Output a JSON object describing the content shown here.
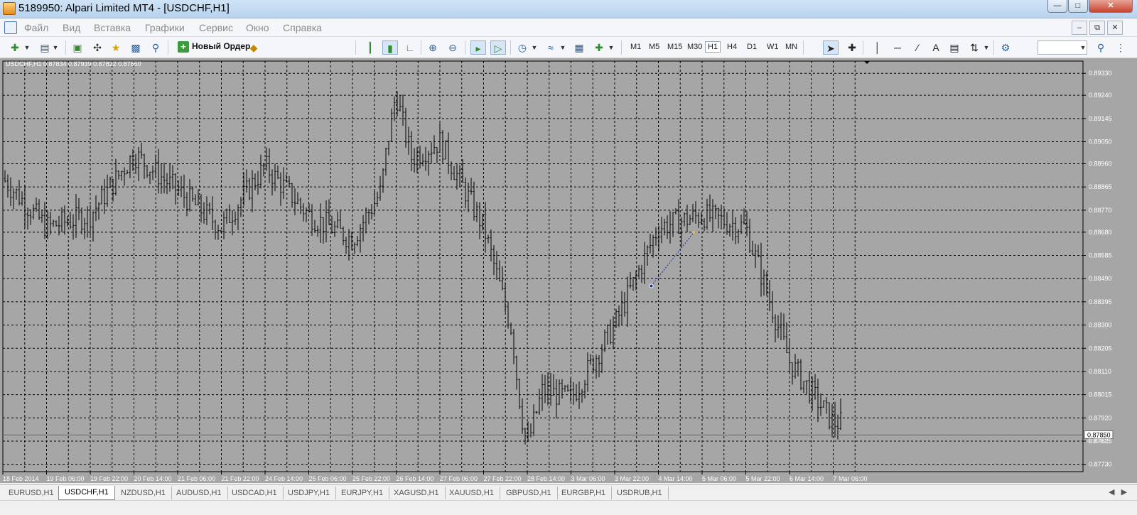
{
  "window": {
    "title": "5189950: Alpari Limited MT4 - [USDCHF,H1]"
  },
  "menu": [
    "Файл",
    "Вид",
    "Вставка",
    "Графики",
    "Сервис",
    "Окно",
    "Справка"
  ],
  "toolbar": {
    "new_order_label": "Новый Ордер",
    "timeframes": [
      "M1",
      "M5",
      "M15",
      "M30",
      "H1",
      "H4",
      "D1",
      "W1",
      "MN"
    ],
    "active_timeframe": "H1",
    "text_tool_label": "A"
  },
  "chart": {
    "symbol_info": "USDCHF,H1  0.87834 0.87939 0.87822 0.87850",
    "current_price": "0.87850",
    "below_price": "0.87825",
    "price_labels": [
      "0.89330",
      "0.89240",
      "0.89145",
      "0.89050",
      "0.88960",
      "0.88865",
      "0.88770",
      "0.88680",
      "0.88585",
      "0.88490",
      "0.88395",
      "0.88300",
      "0.88205",
      "0.88110",
      "0.88015",
      "0.87920",
      "0.87825",
      "0.87730"
    ],
    "time_labels": [
      "18 Feb 2014",
      "19 Feb 06:00",
      "19 Feb 22:00",
      "20 Feb 14:00",
      "21 Feb 06:00",
      "21 Feb 22:00",
      "24 Feb 14:00",
      "25 Feb 06:00",
      "25 Feb 22:00",
      "26 Feb 14:00",
      "27 Feb 06:00",
      "27 Feb 22:00",
      "28 Feb 14:00",
      "3 Mar 06:00",
      "3 Mar 22:00",
      "4 Mar 14:00",
      "5 Mar 06:00",
      "5 Mar 22:00",
      "6 Mar 14:00",
      "7 Mar 06:00"
    ],
    "colors": {
      "background": "#a6a6a6",
      "grid": "#000000",
      "bars": "#000000",
      "text": "#ffffff",
      "trendline": "#1a2aa6"
    }
  },
  "chart_data": {
    "type": "ohlc",
    "symbol": "USDCHF",
    "timeframe": "H1",
    "ylim": [
      0.877,
      0.8938
    ],
    "x": [
      "18 Feb 2014",
      "19 Feb 06:00",
      "19 Feb 22:00",
      "20 Feb 14:00",
      "21 Feb 06:00",
      "21 Feb 22:00",
      "24 Feb 14:00",
      "25 Feb 06:00",
      "25 Feb 22:00",
      "26 Feb 14:00",
      "27 Feb 06:00",
      "27 Feb 22:00",
      "28 Feb 14:00",
      "3 Mar 06:00",
      "3 Mar 22:00",
      "4 Mar 14:00",
      "5 Mar 06:00",
      "5 Mar 22:00",
      "6 Mar 14:00",
      "7 Mar 06:00"
    ],
    "close_path": [
      [
        0,
        0.889
      ],
      [
        1,
        0.887
      ],
      [
        2,
        0.8875
      ],
      [
        3,
        0.89
      ],
      [
        4,
        0.8885
      ],
      [
        5,
        0.887
      ],
      [
        6,
        0.8895
      ],
      [
        7,
        0.8875
      ],
      [
        8,
        0.8865
      ],
      [
        9,
        0.8895
      ],
      [
        10,
        0.8905
      ],
      [
        11,
        0.887
      ],
      [
        12,
        0.8805
      ],
      [
        13,
        0.88
      ],
      [
        14,
        0.883
      ],
      [
        15,
        0.887
      ],
      [
        16,
        0.8875
      ],
      [
        17,
        0.887
      ],
      [
        18,
        0.8815
      ],
      [
        19,
        0.879
      ]
    ],
    "peaks": [
      {
        "x": "26 Feb 14:00",
        "price": 0.893
      },
      {
        "x": "28 Feb 14:00",
        "price": 0.8776
      }
    ]
  },
  "tabs": [
    "EURUSD,H1",
    "USDCHF,H1",
    "NZDUSD,H1",
    "AUDUSD,H1",
    "USDCAD,H1",
    "USDJPY,H1",
    "EURJPY,H1",
    "XAGUSD,H1",
    "XAUUSD,H1",
    "GBPUSD,H1",
    "EURGBP,H1",
    "USDRUB,H1"
  ],
  "active_tab": "USDCHF,H1"
}
